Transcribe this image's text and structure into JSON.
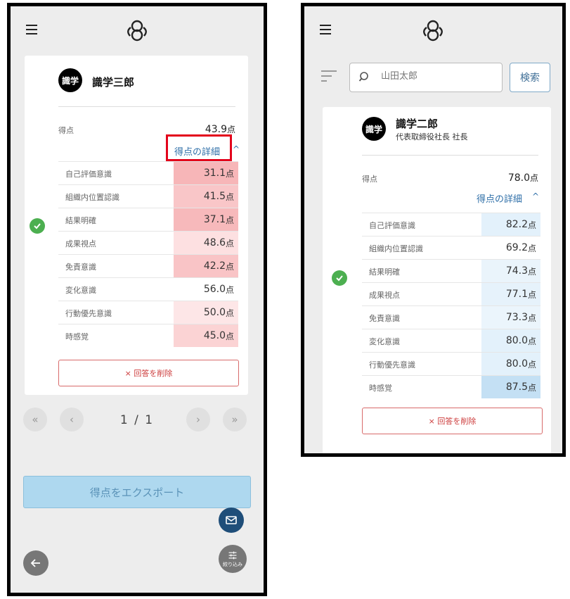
{
  "left": {
    "user": {
      "badge": "識学",
      "name": "識学三郎"
    },
    "score": {
      "label": "得点",
      "value": "43.9",
      "unit": "点"
    },
    "detail_link": "得点の詳細",
    "rows": [
      {
        "label": "自己評価意識",
        "value": "31.1",
        "unit": "点",
        "color": "#f7b6b8"
      },
      {
        "label": "組織内位置認識",
        "value": "41.5",
        "unit": "点",
        "color": "#f9c6c8"
      },
      {
        "label": "結果明確",
        "value": "37.1",
        "unit": "点",
        "color": "#f7b9bb"
      },
      {
        "label": "成果視点",
        "value": "48.6",
        "unit": "点",
        "color": "#fde0e1"
      },
      {
        "label": "免責意識",
        "value": "42.2",
        "unit": "点",
        "color": "#f9c4c6"
      },
      {
        "label": "変化意識",
        "value": "56.0",
        "unit": "点",
        "color": "#ffffff"
      },
      {
        "label": "行動優先意識",
        "value": "50.0",
        "unit": "点",
        "color": "#fde6e7"
      },
      {
        "label": "時感覚",
        "value": "45.0",
        "unit": "点",
        "color": "#fbd3d4"
      }
    ],
    "delete_label": "× 回答を削除",
    "pager": {
      "text": "1 / 1",
      "first": "«",
      "prev": "‹",
      "next": "›",
      "last": "»"
    },
    "export_label": "得点をエクスポート",
    "filter_fab_label": "絞り込み"
  },
  "right": {
    "search": {
      "placeholder": "山田太郎",
      "button": "検索"
    },
    "user": {
      "badge": "識学",
      "name": "識学二郎",
      "title": "代表取締役社長 社長"
    },
    "score": {
      "label": "得点",
      "value": "78.0",
      "unit": "点"
    },
    "detail_link": "得点の詳細",
    "rows": [
      {
        "label": "自己評価意識",
        "value": "82.2",
        "unit": "点",
        "color": "#e3f1fb"
      },
      {
        "label": "組織内位置認識",
        "value": "69.2",
        "unit": "点",
        "color": "#ffffff"
      },
      {
        "label": "結果明確",
        "value": "74.3",
        "unit": "点",
        "color": "#eaf4fb"
      },
      {
        "label": "成果視点",
        "value": "77.1",
        "unit": "点",
        "color": "#e6f2fb"
      },
      {
        "label": "免責意識",
        "value": "73.3",
        "unit": "点",
        "color": "#ebf5fc"
      },
      {
        "label": "変化意識",
        "value": "80.0",
        "unit": "点",
        "color": "#e3f1fb"
      },
      {
        "label": "行動優先意識",
        "value": "80.0",
        "unit": "点",
        "color": "#e3f1fb"
      },
      {
        "label": "時感覚",
        "value": "87.5",
        "unit": "点",
        "color": "#c4e0f4"
      }
    ],
    "delete_label": "× 回答を削除"
  },
  "colors": {
    "accent": "#2f6fa8",
    "danger": "#e3001b",
    "check": "#4caf50",
    "mail_fab": "#1f4e79",
    "gray_fab": "#777777"
  }
}
